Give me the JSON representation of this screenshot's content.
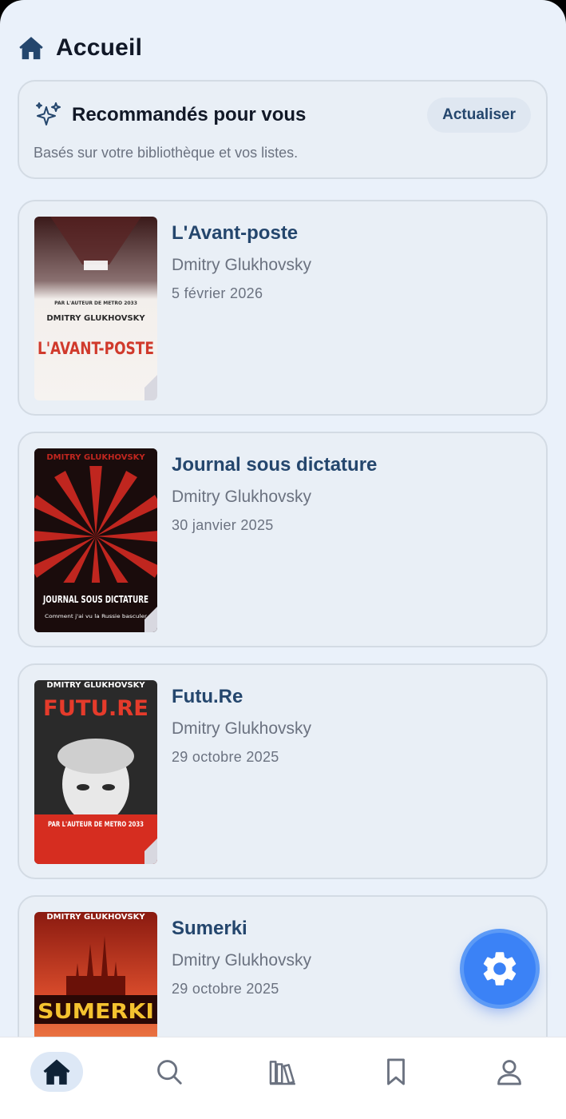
{
  "header": {
    "title": "Accueil",
    "icon": "home-icon"
  },
  "recommendations": {
    "title": "Recommandés pour vous",
    "subtitle": "Basés sur votre bibliothèque et vos listes.",
    "refresh_label": "Actualiser",
    "icon": "sparkles-icon"
  },
  "books": [
    {
      "title": "L'Avant-poste",
      "author": "Dmitry Glukhovsky",
      "date": "5 février 2026",
      "cover": {
        "author_text": "DMITRY GLUKHOVSKY",
        "title_text": "L'AVANT-POSTE",
        "tagline": "PAR L'AUTEUR DE METRO 2033"
      }
    },
    {
      "title": "Journal sous dictature",
      "author": "Dmitry Glukhovsky",
      "date": "30 janvier 2025",
      "cover": {
        "author_text": "DMITRY GLUKHOVSKY",
        "title_text": "JOURNAL SOUS DICTATURE",
        "tagline": "Comment j'ai vu la Russie basculer"
      }
    },
    {
      "title": "Futu.Re",
      "author": "Dmitry Glukhovsky",
      "date": "29 octobre 2025",
      "cover": {
        "author_text": "DMITRY GLUKHOVSKY",
        "title_text": "FUTU.RE",
        "tagline": "PAR L'AUTEUR DE METRO 2033"
      }
    },
    {
      "title": "Sumerki",
      "author": "Dmitry Glukhovsky",
      "date": "29 octobre 2025",
      "cover": {
        "author_text": "DMITRY GLUKHOVSKY",
        "title_text": "SUMERKI"
      }
    }
  ],
  "fab": {
    "icon": "gear-icon"
  },
  "nav": [
    {
      "name": "home",
      "icon": "home-icon",
      "active": true
    },
    {
      "name": "search",
      "icon": "search-icon"
    },
    {
      "name": "library",
      "icon": "library-icon"
    },
    {
      "name": "bookmarks",
      "icon": "bookmark-icon"
    },
    {
      "name": "profile",
      "icon": "user-icon"
    }
  ],
  "colors": {
    "accent": "#3b82f6",
    "title": "#24466d",
    "background": "#eaf1fa"
  }
}
